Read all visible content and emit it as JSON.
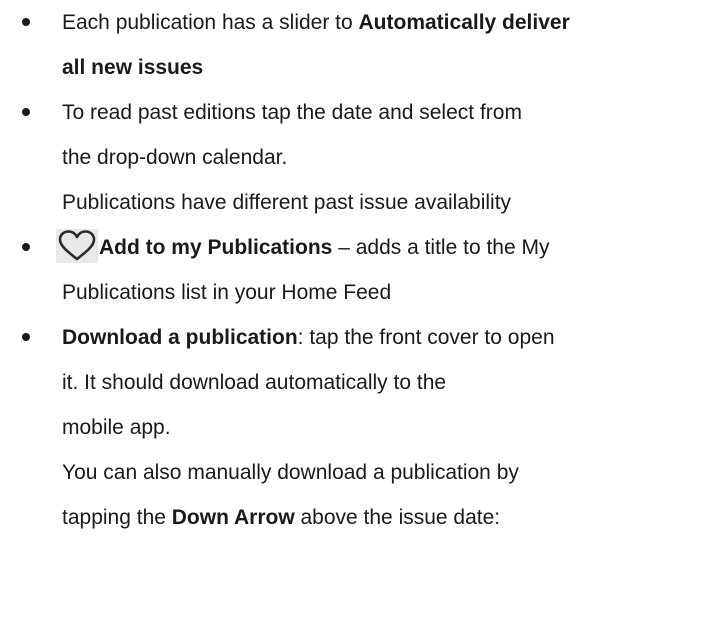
{
  "doc": {
    "bullets": [
      {
        "lines": [
          {
            "segments": [
              {
                "text": "Each publication has a slider to ",
                "bold": false
              },
              {
                "text": "Automatically deliver",
                "bold": true
              }
            ]
          },
          {
            "segments": [
              {
                "text": "all new issues",
                "bold": true
              }
            ]
          }
        ]
      },
      {
        "lines": [
          {
            "segments": [
              {
                "text": "To read past editions tap the date and select from",
                "bold": false
              }
            ]
          },
          {
            "segments": [
              {
                "text": "the drop-down calendar.",
                "bold": false
              }
            ]
          },
          {
            "segments": [
              {
                "text": "Publications have different past issue availability",
                "bold": false
              }
            ]
          }
        ]
      },
      {
        "icon": "heart-icon",
        "lines": [
          {
            "segments": [
              {
                "text": "Add to my Publications",
                "bold": true
              },
              {
                "text": " – adds a title to the My",
                "bold": false
              }
            ]
          },
          {
            "segments": [
              {
                "text": "Publications list in your Home Feed",
                "bold": false
              }
            ]
          }
        ]
      },
      {
        "lines": [
          {
            "segments": [
              {
                "text": "Download a publication",
                "bold": true
              },
              {
                "text": ": tap the front cover to open",
                "bold": false
              }
            ]
          },
          {
            "segments": [
              {
                "text": "it. It should download automatically to the",
                "bold": false
              }
            ]
          },
          {
            "segments": [
              {
                "text": "mobile app.",
                "bold": false
              }
            ]
          },
          {
            "segments": [
              {
                "text": "You can also manually download a publication by",
                "bold": false
              }
            ]
          },
          {
            "segments": [
              {
                "text": "tapping the ",
                "bold": false
              },
              {
                "text": "Down Arrow",
                "bold": true
              },
              {
                "text": " above the issue date:",
                "bold": false
              }
            ]
          }
        ]
      }
    ]
  }
}
